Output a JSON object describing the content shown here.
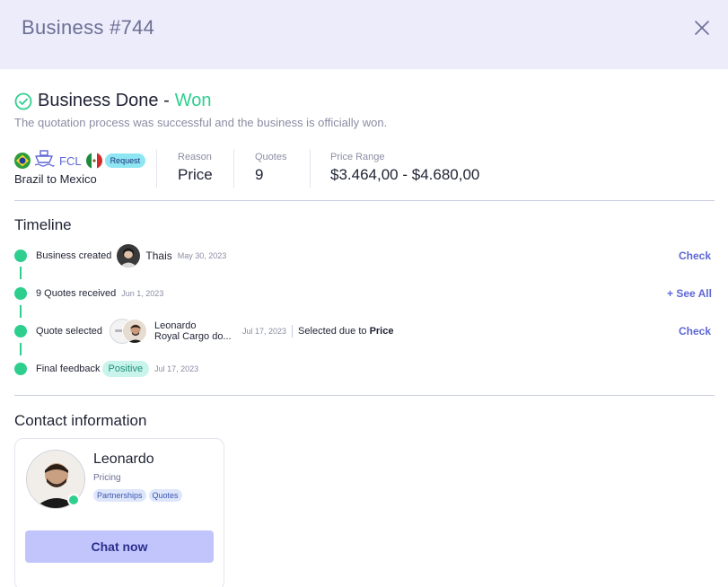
{
  "header": {
    "title": "Business #744"
  },
  "status": {
    "title": "Business Done -",
    "result": "Won",
    "description": "The quotation process was successful and the business is officially won."
  },
  "route": {
    "mode": "FCL",
    "badge": "Request",
    "text": "Brazil to Mexico",
    "origin_flag": "brazil-flag",
    "destination_flag": "mexico-flag"
  },
  "stats": {
    "reason_label": "Reason",
    "reason_value": "Price",
    "quotes_label": "Quotes",
    "quotes_value": "9",
    "price_label": "Price Range",
    "price_value": "$3.464,00 - $4.680,00"
  },
  "timeline": {
    "title": "Timeline",
    "items": [
      {
        "label": "Business created",
        "person": "Thais",
        "date": "May 30, 2023",
        "action": "Check"
      },
      {
        "label": "9 Quotes received",
        "date": "Jun 1, 2023",
        "action": "+ See All"
      },
      {
        "label": "Quote selected",
        "person": "Leonardo",
        "company": "Royal Cargo do...",
        "date": "Jul 17, 2023",
        "note": "Selected due to",
        "note_value": "Price",
        "action": "Check"
      },
      {
        "label": "Final feedback",
        "badge": "Positive",
        "date": "Jul 17, 2023"
      }
    ]
  },
  "contact": {
    "title": "Contact information",
    "name": "Leonardo",
    "role": "Pricing",
    "tags": [
      "Partnerships",
      "Quotes"
    ],
    "chat_label": "Chat now"
  },
  "colors": {
    "accent": "#5d67d6",
    "success": "#2ecf8e",
    "header_bg": "#ececfb"
  }
}
